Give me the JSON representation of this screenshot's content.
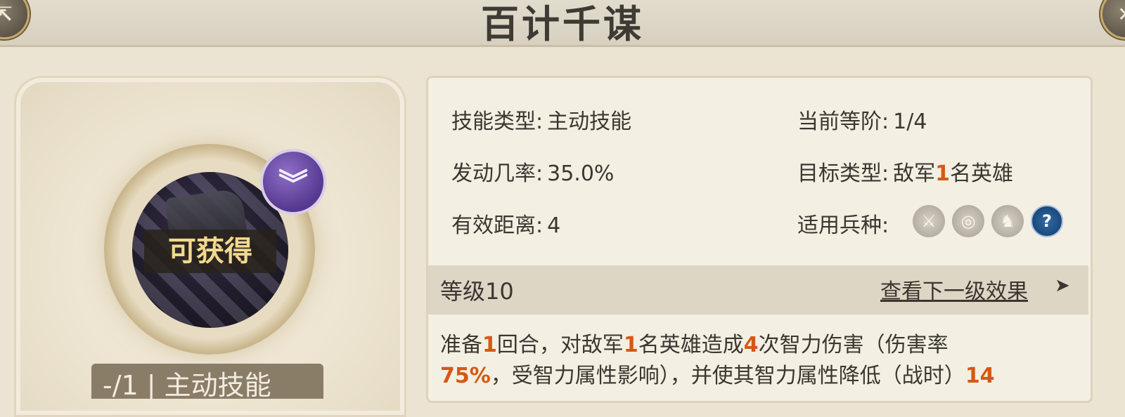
{
  "header": {
    "title": "百计千谋",
    "left_button_icon": "exit-icon",
    "right_button_icon": "close-icon"
  },
  "skill_card": {
    "status_label": "可获得",
    "rank_badge_icon": "chevron-rank-icon",
    "bottom_tag": "-/1 | 主动技能"
  },
  "stats": {
    "skill_type_label": "技能类型:",
    "skill_type_value": "主动技能",
    "current_tier_label": "当前等阶:",
    "current_tier_value": "1/4",
    "trigger_rate_label": "发动几率:",
    "trigger_rate_value": "35.0%",
    "target_type_label": "目标类型:",
    "target_type_value_prefix": "敌军",
    "target_type_value_num": "1",
    "target_type_value_suffix": "名英雄",
    "range_label": "有效距离:",
    "range_value": "4",
    "troop_label": "适用兵种:",
    "troop_icons": [
      "sword-icon",
      "bow-target-icon",
      "horse-icon",
      "question-icon"
    ]
  },
  "level": {
    "label": "等级10",
    "next_link": "查看下一级效果",
    "next_arrow": "➤"
  },
  "description": {
    "p1": "准备",
    "n1": "1",
    "p2": "回合，对敌军",
    "n2": "1",
    "p3": "名英雄造成",
    "n3": "4",
    "p4": "次智力伤害（伤害率",
    "n4": "75%",
    "p5": "，受智力属性影响），并使其智力属性降低（战时）",
    "n5": "14"
  },
  "colors": {
    "highlight": "#d25a16",
    "panel_bg": "#f4efe3",
    "page_bg": "#ece4d2"
  }
}
